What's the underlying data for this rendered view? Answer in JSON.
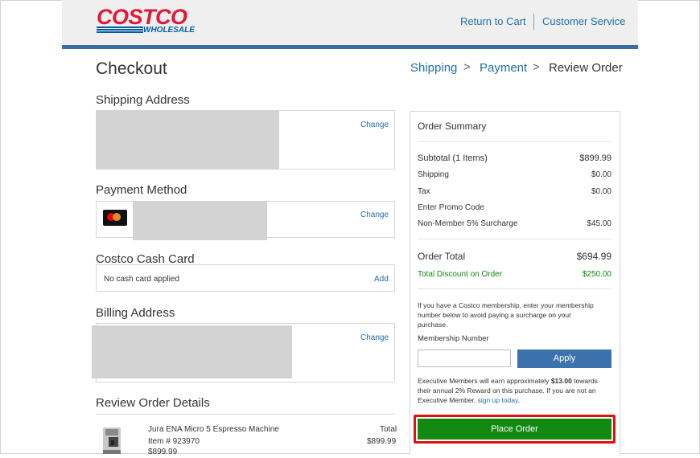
{
  "header": {
    "logo_top": "COSTCO",
    "logo_bottom": "WHOLESALE",
    "return_to_cart": "Return to Cart",
    "customer_service": "Customer Service"
  },
  "page": {
    "title": "Checkout",
    "breadcrumb": [
      "Shipping",
      "Payment",
      "Review Order"
    ],
    "breadcrumb_sep": ">"
  },
  "shipping": {
    "title": "Shipping Address",
    "change": "Change"
  },
  "payment": {
    "title": "Payment Method",
    "change": "Change",
    "card_icon": "mastercard-icon"
  },
  "cash_card": {
    "title": "Costco Cash Card",
    "status": "No cash card applied",
    "add": "Add"
  },
  "billing": {
    "title": "Billing Address",
    "change": "Change"
  },
  "review": {
    "title": "Review Order Details",
    "item_name": "Jura ENA Micro 5 Espresso Machine",
    "item_number": "Item # 923970",
    "item_price": "$899.99",
    "total_label": "Total",
    "total_value": "$899.99"
  },
  "summary": {
    "title": "Order Summary",
    "subtotal_label": "Subtotal (1 Items)",
    "subtotal_value": "$899.99",
    "shipping_label": "Shipping",
    "shipping_value": "$0.00",
    "tax_label": "Tax",
    "tax_value": "$0.00",
    "promo_link": "Enter Promo Code",
    "surcharge_label": "Non-Member 5% Surcharge",
    "surcharge_value": "$45.00",
    "order_total_label": "Order Total",
    "order_total_value": "$694.99",
    "discount_label": "Total Discount on Order",
    "discount_value": "$250.00",
    "membership_note_1": "If you have a Costco membership, enter your membership",
    "membership_note_2": "number below to avoid paying a surcharge on your",
    "membership_note_3": "purchase.",
    "membership_label": "Membership Number",
    "membership_placeholder": "",
    "apply_button": "Apply",
    "exec_1_a": "Executive Members will earn approximately ",
    "exec_1_b": "$13.00",
    "exec_1_c": " towards",
    "exec_2": "their annual 2% Reward on this purchase. If you are not an",
    "exec_3_a": "Executive Member, ",
    "exec_3_link": "sign up today",
    "exec_3_b": ".",
    "place_order": "Place Order"
  },
  "colors": {
    "brand_red": "#e31837",
    "brand_blue": "#005daa",
    "header_bar": "#3a6ea0",
    "link": "#1f6fa8",
    "apply_button": "#3a72ad",
    "place_order_button": "#128a12",
    "place_order_highlight": "#e01010",
    "discount_green": "#128a12"
  }
}
